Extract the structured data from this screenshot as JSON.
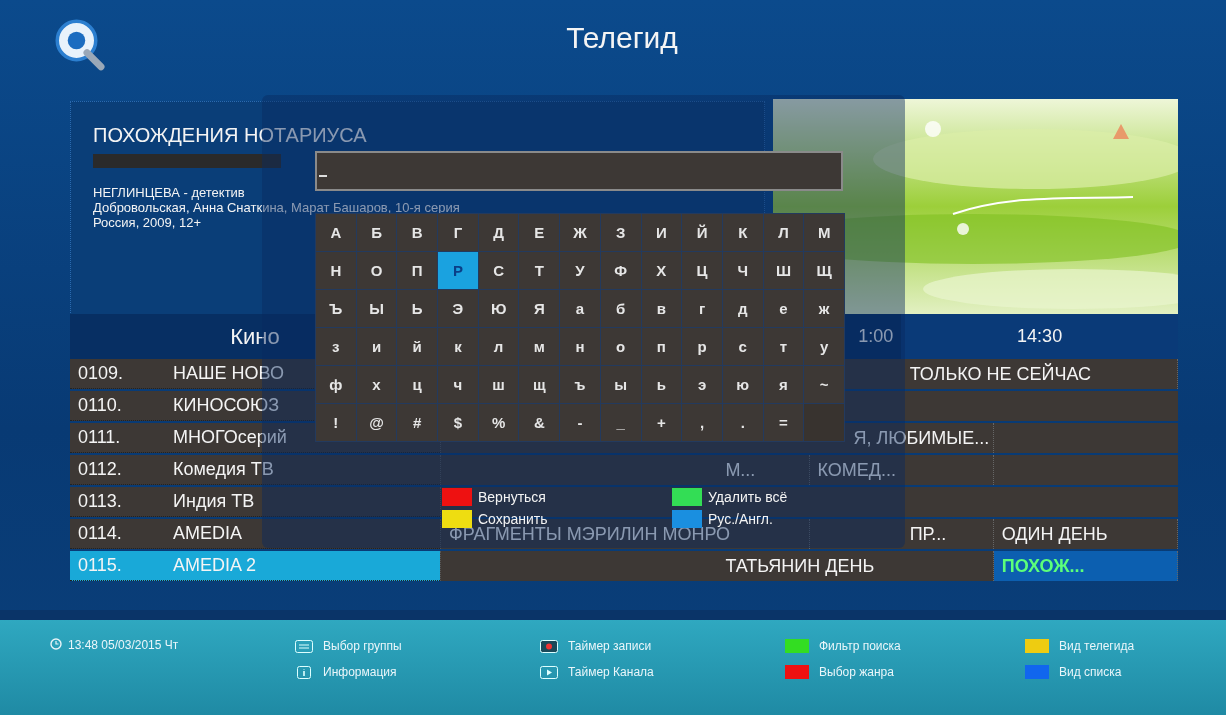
{
  "header": {
    "title": "Телегид"
  },
  "info": {
    "title": "ПОХОЖДЕНИЯ НОТАРИУСА",
    "progress": {
      "level": 0
    },
    "lines": [
      "НЕГЛИНЦЕВА - детектив",
      "Добровольская, Анна Снаткина, Марат Башаров, 10-я серия",
      "Россия, 2009, 12+"
    ]
  },
  "preview": {
    "kind": "picture"
  },
  "group": "Кино",
  "times": [
    "1:00",
    "14:30"
  ],
  "rows": [
    {
      "number": "0109.",
      "name": "НАШЕ НОВО",
      "selected": false,
      "programs": [
        {
          "title": "ТОЛЬКО НЕ СЕЙЧАС",
          "selected": false
        }
      ]
    },
    {
      "number": "0110.",
      "name": "КИНОСОЮЗ",
      "selected": false,
      "programs": []
    },
    {
      "number": "0111.",
      "name": "МНОГОсерий",
      "selected": false,
      "programs": [
        {
          "title": "Я, ЛЮБИМЫЕ...",
          "selected": false
        }
      ]
    },
    {
      "number": "0112.",
      "name": "Комедия ТВ",
      "selected": false,
      "programs": [
        {
          "title": "М...",
          "selected": false
        },
        {
          "title": "КОМЕД...",
          "selected": false
        }
      ]
    },
    {
      "number": "0113.",
      "name": "Индия ТВ",
      "selected": false,
      "programs": []
    },
    {
      "number": "0114.",
      "name": "AMEDIA",
      "selected": false,
      "programs": [
        {
          "title": "ФРАГМЕНТЫ МЭРИЛИН МОНРО",
          "selected": false
        },
        {
          "title": "ПР...",
          "selected": false
        },
        {
          "title": "ОДИН ДЕНЬ",
          "selected": false
        }
      ]
    },
    {
      "number": "0115.",
      "name": "AMEDIA 2",
      "selected": true,
      "programs": [
        {
          "title": "ТАТЬЯНИН ДЕНЬ",
          "selected": false
        },
        {
          "title": "ПОХОЖ...",
          "selected": true
        }
      ]
    }
  ],
  "keyboard": {
    "keys": [
      [
        {
          "char": "А",
          "selected": false
        },
        {
          "char": "Б",
          "selected": false
        },
        {
          "char": "В",
          "selected": false
        },
        {
          "char": "Г",
          "selected": false
        },
        {
          "char": "Д",
          "selected": false
        },
        {
          "char": "Е",
          "selected": false
        },
        {
          "char": "Ж",
          "selected": false
        },
        {
          "char": "З",
          "selected": false
        },
        {
          "char": "И",
          "selected": false
        },
        {
          "char": "Й",
          "selected": false
        },
        {
          "char": "К",
          "selected": false
        },
        {
          "char": "Л",
          "selected": false
        },
        {
          "char": "М",
          "selected": false
        }
      ],
      [
        {
          "char": "Н",
          "selected": false
        },
        {
          "char": "О",
          "selected": false
        },
        {
          "char": "П",
          "selected": false
        },
        {
          "char": "Р",
          "selected": true
        },
        {
          "char": "С",
          "selected": false
        },
        {
          "char": "Т",
          "selected": false
        },
        {
          "char": "У",
          "selected": false
        },
        {
          "char": "Ф",
          "selected": false
        },
        {
          "char": "Х",
          "selected": false
        },
        {
          "char": "Ц",
          "selected": false
        },
        {
          "char": "Ч",
          "selected": false
        },
        {
          "char": "Ш",
          "selected": false
        },
        {
          "char": "Щ",
          "selected": false
        }
      ],
      [
        {
          "char": "Ъ",
          "selected": false
        },
        {
          "char": "Ы",
          "selected": false
        },
        {
          "char": "Ь",
          "selected": false
        },
        {
          "char": "Э",
          "selected": false
        },
        {
          "char": "Ю",
          "selected": false
        },
        {
          "char": "Я",
          "selected": false
        },
        {
          "char": "а",
          "selected": false
        },
        {
          "char": "б",
          "selected": false
        },
        {
          "char": "в",
          "selected": false
        },
        {
          "char": "г",
          "selected": false
        },
        {
          "char": "д",
          "selected": false
        },
        {
          "char": "е",
          "selected": false
        },
        {
          "char": "ж",
          "selected": false
        }
      ],
      [
        {
          "char": "з",
          "selected": false
        },
        {
          "char": "и",
          "selected": false
        },
        {
          "char": "й",
          "selected": false
        },
        {
          "char": "к",
          "selected": false
        },
        {
          "char": "л",
          "selected": false
        },
        {
          "char": "м",
          "selected": false
        },
        {
          "char": "н",
          "selected": false
        },
        {
          "char": "о",
          "selected": false
        },
        {
          "char": "п",
          "selected": false
        },
        {
          "char": "р",
          "selected": false
        },
        {
          "char": "с",
          "selected": false
        },
        {
          "char": "т",
          "selected": false
        },
        {
          "char": "у",
          "selected": false
        }
      ],
      [
        {
          "char": "ф",
          "selected": false
        },
        {
          "char": "х",
          "selected": false
        },
        {
          "char": "ц",
          "selected": false
        },
        {
          "char": "ч",
          "selected": false
        },
        {
          "char": "ш",
          "selected": false
        },
        {
          "char": "щ",
          "selected": false
        },
        {
          "char": "ъ",
          "selected": false
        },
        {
          "char": "ы",
          "selected": false
        },
        {
          "char": "ь",
          "selected": false
        },
        {
          "char": "э",
          "selected": false
        },
        {
          "char": "ю",
          "selected": false
        },
        {
          "char": "я",
          "selected": false
        },
        {
          "char": "~",
          "selected": false
        }
      ],
      [
        {
          "char": "!",
          "selected": false
        },
        {
          "char": "@",
          "selected": false
        },
        {
          "char": "#",
          "selected": false
        },
        {
          "char": "$",
          "selected": false
        },
        {
          "char": "%",
          "selected": false
        },
        {
          "char": "&",
          "selected": false
        },
        {
          "char": "-",
          "selected": false
        },
        {
          "char": "_",
          "selected": false
        },
        {
          "char": "+",
          "selected": false
        },
        {
          "char": ",",
          "selected": false
        },
        {
          "char": ".",
          "selected": false
        },
        {
          "char": "=",
          "selected": false
        },
        {
          "kind": "blank",
          "selected": false
        }
      ]
    ],
    "legend": [
      {
        "label": "Вернуться",
        "color": "#ee1111"
      },
      {
        "label": "Удалить всё",
        "color": "#33dd55"
      },
      {
        "label": "Сохранить",
        "color": "#eedd11"
      },
      {
        "label": "Рус./Англ.",
        "color": "#1a8fe0"
      }
    ]
  },
  "footer": {
    "clock": "13:48 05/03/2015 Чт",
    "hints": [
      {
        "kind": "list",
        "label": "Выбор группы"
      },
      {
        "kind": "info",
        "label": "Информация"
      },
      {
        "kind": "record",
        "label": "Таймер записи"
      },
      {
        "kind": "play",
        "label": "Таймер Канала"
      },
      {
        "kind": "color",
        "color": "#33dd22",
        "label": "Фильтр поиска"
      },
      {
        "kind": "color",
        "color": "#ee1111",
        "label": "Выбор жанра"
      },
      {
        "kind": "color",
        "color": "#eecc11",
        "label": "Вид телегида"
      },
      {
        "kind": "color",
        "color": "#1166ee",
        "label": "Вид списка"
      }
    ]
  }
}
